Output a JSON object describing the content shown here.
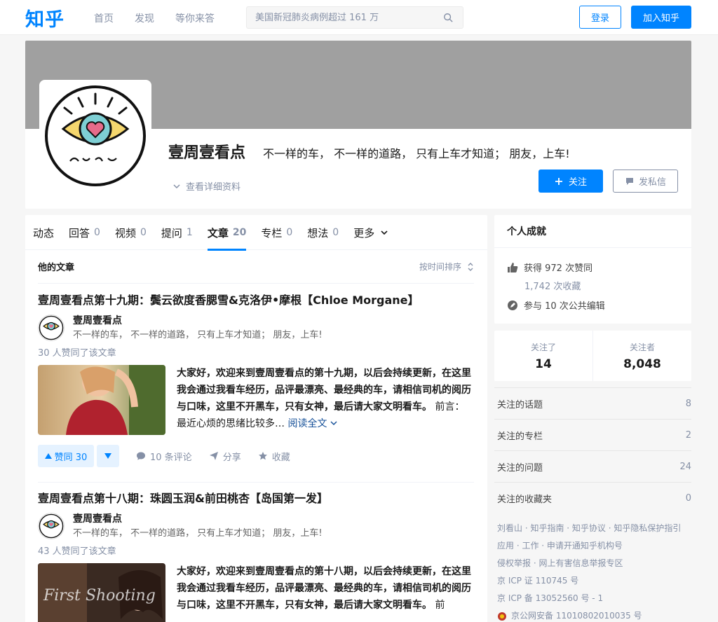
{
  "header": {
    "logo": "知乎",
    "nav": [
      "首页",
      "发现",
      "等你来答"
    ],
    "search_placeholder": "美国新冠肺炎病例超过 161 万",
    "login": "登录",
    "join": "加入知乎"
  },
  "profile": {
    "name": "壹周壹看点",
    "headline": "不一样的车， 不一样的道路， 只有上车才知道； 朋友，上车!",
    "detail_link": "查看详细资料",
    "follow": "关注",
    "message": "发私信"
  },
  "tabs": [
    {
      "label": "动态",
      "count": ""
    },
    {
      "label": "回答",
      "count": "0"
    },
    {
      "label": "视频",
      "count": "0"
    },
    {
      "label": "提问",
      "count": "1"
    },
    {
      "label": "文章",
      "count": "20"
    },
    {
      "label": "专栏",
      "count": "0"
    },
    {
      "label": "想法",
      "count": "0"
    },
    {
      "label": "更多",
      "count": ""
    }
  ],
  "section": {
    "title": "他的文章",
    "sort": "按时间排序"
  },
  "articles": [
    {
      "title": "壹周壹看点第十九期：鬓云欲度香腮雪&克洛伊•摩根【Chloe Morgane】",
      "author": "壹周壹看点",
      "author_headline": "不一样的车， 不一样的道路， 只有上车才知道； 朋友，上车!",
      "likes": "30 人赞同了该文章",
      "excerpt_bold": "大家好，欢迎来到壹周壹看点的第十九期，以后会持续更新，在这里我会通过我看车经历，品评最漂亮、最经典的车，请相信司机的阅历与口味，这里不开黑车，只有女神，最后请大家文明看车。",
      "excerpt": " 前言：最近心烦的思绪比较多…",
      "read_all": "阅读全文",
      "vote": "赞同 30",
      "comments": "10 条评论",
      "share": "分享",
      "favorite": "收藏"
    },
    {
      "title": "壹周壹看点第十八期：珠圆玉润&前田桃杏【岛国第一发】",
      "author": "壹周壹看点",
      "author_headline": "不一样的车， 不一样的道路， 只有上车才知道； 朋友，上车!",
      "likes": "43 人赞同了该文章",
      "excerpt_bold": "大家好，欢迎来到壹周壹看点的第十八期，以后会持续更新，在这里我会通过我看车经历，品评最漂亮、最经典的车，请相信司机的阅历与口味，这里不开黑车，只有女神，最后请大家文明看车。",
      "excerpt": " 前",
      "thumb_text": "First Shooting"
    }
  ],
  "achievements": {
    "title": "个人成就",
    "likes": "获得 972 次赞同",
    "favorites": "1,742 次收藏",
    "edits": "参与 10 次公共编辑"
  },
  "follow_stats": {
    "following_label": "关注了",
    "following": "14",
    "followers_label": "关注者",
    "followers": "8,048"
  },
  "side_list": [
    {
      "label": "关注的话题",
      "count": "8"
    },
    {
      "label": "关注的专栏",
      "count": "2"
    },
    {
      "label": "关注的问题",
      "count": "24"
    },
    {
      "label": "关注的收藏夹",
      "count": "0"
    }
  ],
  "footer": [
    "刘看山 · 知乎指南 · 知乎协议 · 知乎隐私保护指引",
    "应用 · 工作 · 申请开通知乎机构号",
    "侵权举报 · 网上有害信息举报专区",
    "京 ICP 证 110745 号",
    "京 ICP 备 13052560 号 - 1",
    "京公网安备 11010802010035 号"
  ],
  "colors": {
    "brand": "#0084ff",
    "muted": "#8590a6",
    "link": "#175199"
  }
}
